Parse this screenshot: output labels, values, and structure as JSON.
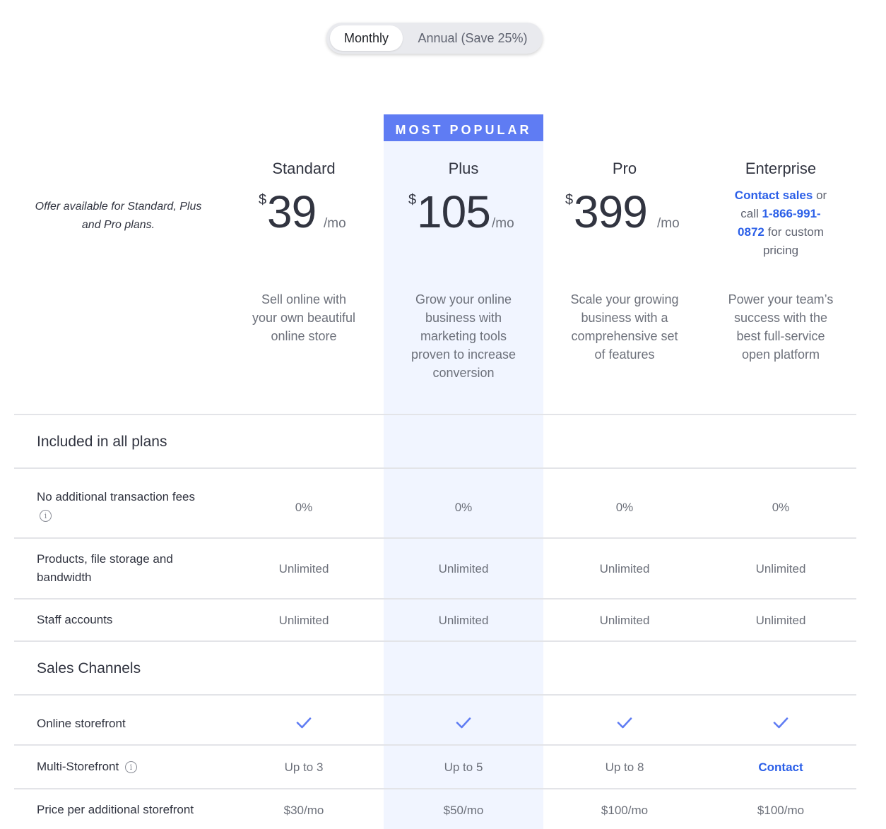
{
  "toggle": {
    "monthly": "Monthly",
    "annual": "Annual (Save 25%)"
  },
  "badge": "MOST POPULAR",
  "offer_note": "Offer available for Standard, Plus and Pro plans.",
  "plans": [
    {
      "name": "Standard",
      "currency": "$",
      "amount": "39",
      "period": "/mo",
      "description": "Sell online with your own beautiful online store"
    },
    {
      "name": "Plus",
      "currency": "$",
      "amount": "105",
      "period": "/mo",
      "description": "Grow your online business with marketing tools proven to increase conversion"
    },
    {
      "name": "Pro",
      "currency": "$",
      "amount": "399",
      "period": "/mo",
      "description": "Scale your growing business with a comprehensive set of features"
    },
    {
      "name": "Enterprise",
      "description": "Power your team’s success with the best full-service open platform"
    }
  ],
  "enterprise_contact": {
    "link": "Contact sales",
    "t1": "or call",
    "phone": "1-866-991-0872",
    "t2": "for custom pricing"
  },
  "sections": {
    "included": "Included in all plans",
    "sales": "Sales Channels"
  },
  "rows": {
    "fees": {
      "label": "No additional transaction fees",
      "values": [
        "0%",
        "0%",
        "0%",
        "0%"
      ]
    },
    "products": {
      "label": "Products, file storage and bandwidth",
      "values": [
        "Unlimited",
        "Unlimited",
        "Unlimited",
        "Unlimited"
      ]
    },
    "staff": {
      "label": "Staff accounts",
      "values": [
        "Unlimited",
        "Unlimited",
        "Unlimited",
        "Unlimited"
      ]
    },
    "storefront": {
      "label": "Online storefront",
      "values": [
        "check-icon",
        "check-icon",
        "check-icon",
        "check-icon"
      ]
    },
    "multi": {
      "label": "Multi-Storefront",
      "values": [
        "Up to 3",
        "Up to 5",
        "Up to 8",
        "Contact"
      ]
    },
    "additional": {
      "label": "Price per additional storefront",
      "values": [
        "$30/mo",
        "$50/mo",
        "$100/mo",
        "$100/mo"
      ]
    }
  },
  "colors": {
    "accent": "#5f7cf3",
    "link": "#2b5fe8",
    "highlight": "#f1f5ff"
  }
}
